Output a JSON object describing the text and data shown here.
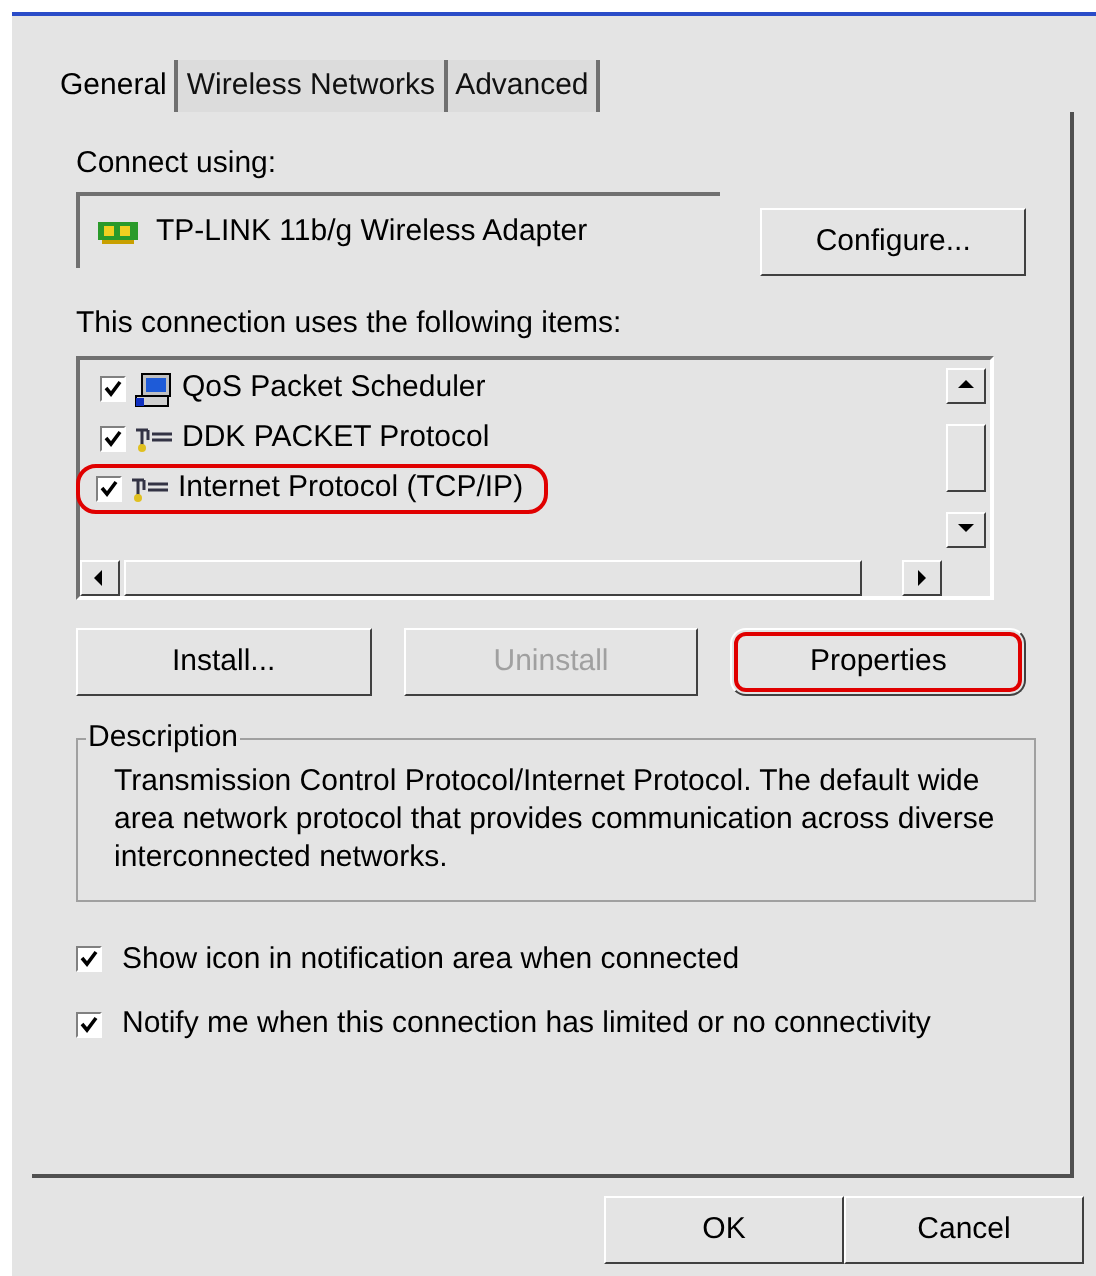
{
  "tabs": [
    {
      "label": "General",
      "selected": true
    },
    {
      "label": "Wireless Networks",
      "selected": false
    },
    {
      "label": "Advanced",
      "selected": false
    }
  ],
  "connect_using": {
    "label": "Connect using:",
    "adapter": "TP-LINK 11b/g Wireless Adapter",
    "configure_button": "Configure..."
  },
  "items_label": "This connection uses the following items:",
  "items": [
    {
      "label": "QoS Packet Scheduler",
      "kind": "scheduler",
      "checked": true,
      "highlighted": false
    },
    {
      "label": "DDK PACKET Protocol",
      "kind": "protocol",
      "checked": true,
      "highlighted": false
    },
    {
      "label": "Internet Protocol (TCP/IP)",
      "kind": "protocol",
      "checked": true,
      "highlighted": true
    }
  ],
  "item_buttons": [
    {
      "label": "Install...",
      "disabled": false,
      "highlighted": false
    },
    {
      "label": "Uninstall",
      "disabled": true,
      "highlighted": false
    },
    {
      "label": "Properties",
      "disabled": false,
      "highlighted": true
    }
  ],
  "description": {
    "title": "Description",
    "text": "Transmission Control Protocol/Internet Protocol. The default wide area network protocol that provides communication across diverse interconnected networks."
  },
  "options": [
    {
      "label": "Show icon in notification area when connected",
      "checked": true
    },
    {
      "label": "Notify me when this connection has limited or no connectivity",
      "checked": true
    }
  ],
  "dialog_buttons": [
    "OK",
    "Cancel"
  ]
}
